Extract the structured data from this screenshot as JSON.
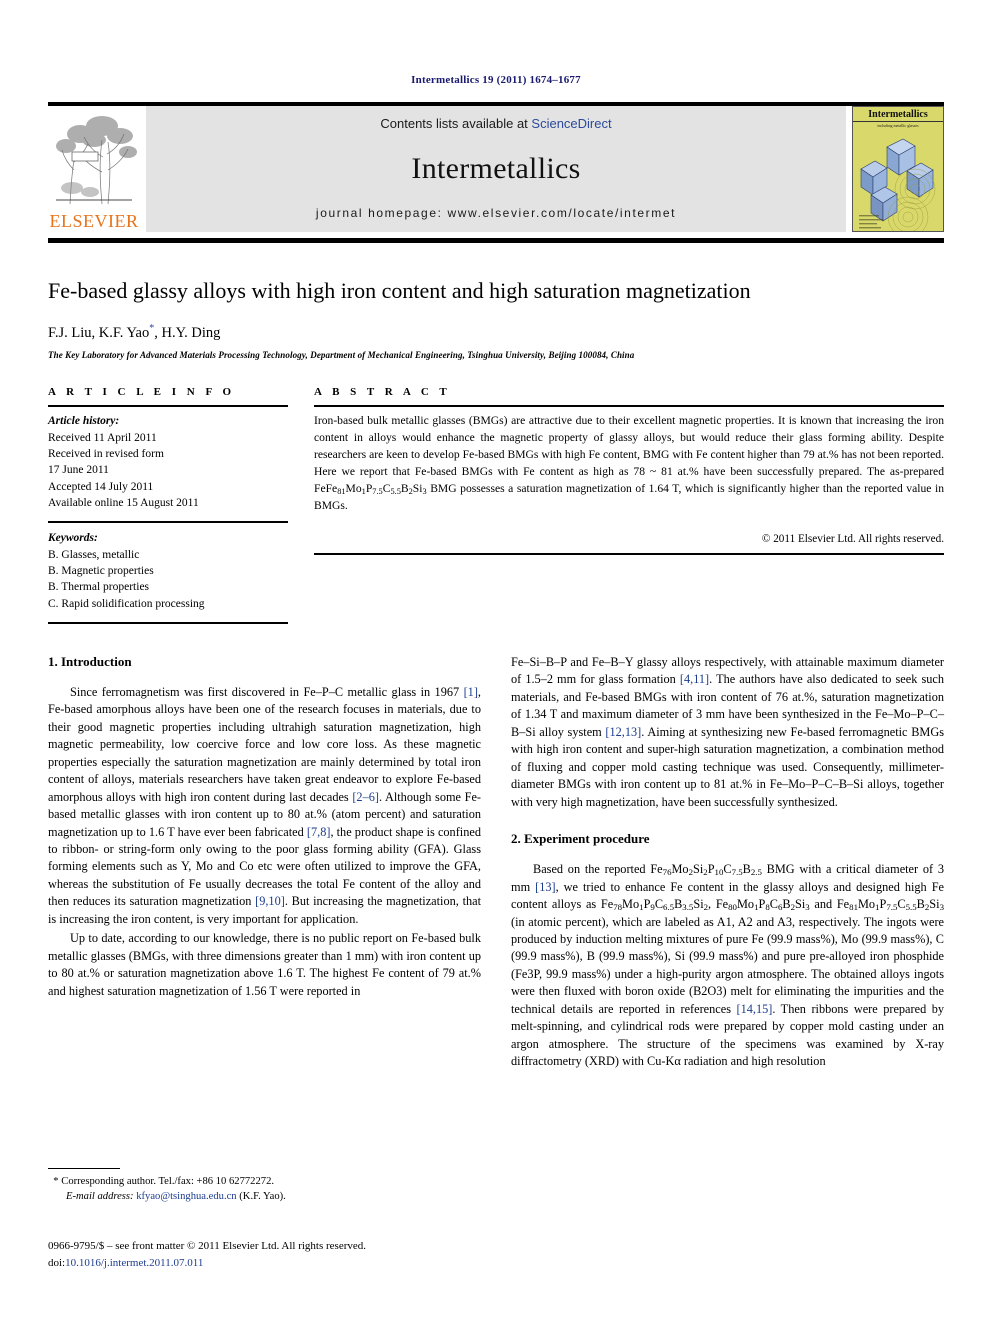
{
  "running_head": "Intermetallics 19 (2011) 1674–1677",
  "masthead": {
    "publisher_name": "ELSEVIER",
    "contents_prefix": "Contents lists available at ",
    "contents_link": "ScienceDirect",
    "journal_name": "Intermetallics",
    "homepage_line": "journal homepage: www.elsevier.com/locate/intermet",
    "cover_title": "Intermetallics",
    "cover_subtitle": "including metallic glasses",
    "accent_orange": "#E8731A",
    "link_blue": "#2b4a9b",
    "cover_bg": "#d9d96b",
    "band_bg": "#e3e3e3"
  },
  "title": "Fe-based glassy alloys with high iron content and high saturation magnetization",
  "authors": "F.J. Liu, K.F. Yao",
  "authors_tail": ", H.Y. Ding",
  "affiliation": "The Key Laboratory for Advanced Materials Processing Technology, Department of Mechanical Engineering, Tsinghua University, Beijing 100084, China",
  "article_info": {
    "heading": "A R T I C L E   I N F O",
    "history_label": "Article history:",
    "history": [
      "Received 11 April 2011",
      "Received in revised form",
      "17 June 2011",
      "Accepted 14 July 2011",
      "Available online 15 August 2011"
    ],
    "keywords_label": "Keywords:",
    "keywords": [
      "B. Glasses, metallic",
      "B. Magnetic properties",
      "B. Thermal properties",
      "C. Rapid solidification processing"
    ]
  },
  "abstract": {
    "heading": "A B S T R A C T",
    "text_part1": "Iron-based bulk metallic glasses (BMGs) are attractive due to their excellent magnetic properties. It is known that increasing the iron content in alloys would enhance the magnetic property of glassy alloys, but would reduce their glass forming ability. Despite researchers are keen to develop Fe-based BMGs with high Fe content, BMG with Fe content higher than 79 at.% has not been reported. Here we report that Fe-based BMGs with Fe content as high as 78 ~ 81 at.% have been successfully prepared. The as-prepared Fe",
    "formula": "Fe81Mo1P7.5C5.5B2Si3",
    "text_part2": " BMG possesses a saturation magnetization of 1.64 T, which is significantly higher than the reported value in BMGs.",
    "copyright": "© 2011 Elsevier Ltd. All rights reserved."
  },
  "sections": {
    "intro_heading": "1. Introduction",
    "experiment_heading": "2. Experiment procedure"
  },
  "left_column": {
    "para1_a": "Since ferromagnetism was first discovered in Fe–P–C metallic glass in 1967 ",
    "para1_ref1": "[1]",
    "para1_b": ", Fe-based amorphous alloys have been one of the research focuses in materials, due to their good magnetic properties including ultrahigh saturation magnetization, high magnetic permeability, low coercive force and low core loss. As these magnetic properties especially the saturation magnetization are mainly determined by total iron content of alloys, materials researchers have taken great endeavor to explore Fe-based amorphous alloys with high iron content during last decades ",
    "para1_ref2": "[2–6]",
    "para1_c": ". Although some Fe-based metallic glasses with iron content up to 80 at.% (atom percent) and saturation magnetization up to 1.6 T have ever been fabricated ",
    "para1_ref3": "[7,8]",
    "para1_d": ", the product shape is confined to ribbon- or string-form only owing to the poor glass forming ability (GFA). Glass forming elements such as Y, Mo and Co etc were often utilized to improve the GFA, whereas the substitution of Fe usually decreases the total Fe content of the alloy and then reduces its saturation magnetization ",
    "para1_ref4": "[9,10]",
    "para1_e": ". But increasing the magnetization, that is increasing the iron content, is very important for application.",
    "para2": "Up to date, according to our knowledge, there is no public report on Fe-based bulk metallic glasses (BMGs, with three dimensions greater than 1 mm) with iron content up to 80 at.% or saturation magnetization above 1.6 T. The highest Fe content of 79 at.% and highest saturation magnetization of 1.56 T were reported in"
  },
  "right_column": {
    "para1_a": "Fe–Si–B–P and Fe–B–Y glassy alloys respectively, with attainable maximum diameter of 1.5–2 mm for glass formation ",
    "para1_ref1": "[4,11]",
    "para1_b": ". The authors have also dedicated to seek such materials, and Fe-based BMGs with iron content of 76 at.%, saturation magnetization of 1.34 T and maximum diameter of 3 mm have been synthesized in the Fe–Mo–P–C–B–Si alloy system ",
    "para1_ref2": "[12,13]",
    "para1_c": ". Aiming at synthesizing new Fe-based ferromagnetic BMGs with high iron content and super-high saturation magnetization, a combination method of fluxing and copper mold casting technique was used. Consequently, millimeter-diameter BMGs with iron content up to 81 at.% in Fe–Mo–P–C–B–Si alloys, together with very high magnetization, have been successfully synthesized.",
    "para2_a": "Based on the reported ",
    "para2_formula1": "Fe76Mo2Si2P10C7.5B2.5",
    "para2_b": " BMG with a critical diameter of 3 mm ",
    "para2_ref1": "[13]",
    "para2_c": ", we tried to enhance Fe content in the glassy alloys and designed high Fe content alloys as ",
    "para2_formula2": "Fe78Mo1P9C6.5B3.5Si2",
    "para2_d": ", ",
    "para2_formula3": "Fe80Mo1P8C6B2Si3",
    "para2_e": " and ",
    "para2_formula4": "Fe81Mo1P7.5C5.5B2Si3",
    "para2_f": " (in atomic percent), which are labeled as A1, A2 and A3, respectively. The ingots were produced by induction melting mixtures of pure Fe (99.9 mass%), Mo (99.9 mass%), C (99.9 mass%), B (99.9 mass%), Si (99.9 mass%) and pure pre-alloyed iron phosphide (Fe3P, 99.9 mass%) under a high-purity argon atmosphere. The obtained alloys ingots were then fluxed with boron oxide (B2O3) melt for eliminating the impurities and the technical details are reported in references ",
    "para2_ref2": "[14,15]",
    "para2_g": ". Then ribbons were prepared by melt-spinning, and cylindrical rods were prepared by copper mold casting under an argon atmosphere. The structure of the specimens was examined by X-ray diffractometry (XRD) with Cu-Kα radiation and high resolution"
  },
  "footnotes": {
    "corresponding_marker": "*",
    "corresponding_text": "Corresponding author. Tel./fax: +86 10 62772272.",
    "email_label": "E-mail address:",
    "email": "kfyao@tsinghua.edu.cn",
    "email_owner": "(K.F. Yao).",
    "issn_line": "0966-9795/$ – see front matter © 2011 Elsevier Ltd. All rights reserved.",
    "doi_prefix": "doi:",
    "doi_value": "10.1016/j.intermet.2011.07.011"
  }
}
